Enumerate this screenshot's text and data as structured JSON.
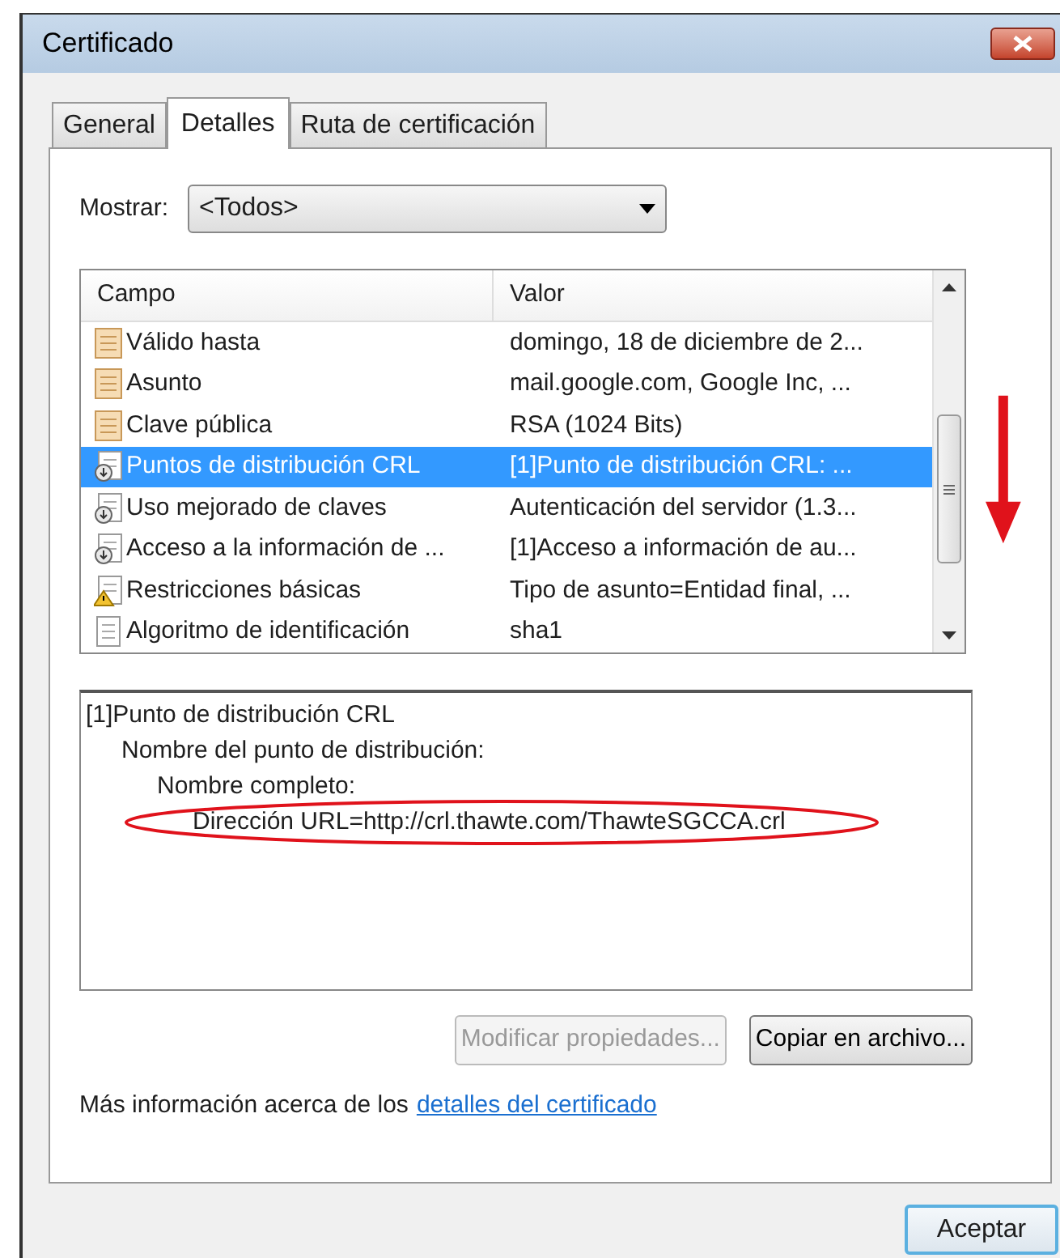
{
  "window": {
    "title": "Certificado"
  },
  "tabs": [
    {
      "label": "General",
      "selected": false
    },
    {
      "label": "Detalles",
      "selected": true
    },
    {
      "label": "Ruta de certificación",
      "selected": false
    }
  ],
  "show": {
    "label": "Mostrar:",
    "value": "<Todos>"
  },
  "fields": {
    "columns": [
      "Campo",
      "Valor"
    ],
    "rows": [
      {
        "kind": "cert",
        "field": "Válido hasta",
        "value": "domingo, 18 de diciembre de 2...",
        "selected": false
      },
      {
        "kind": "cert",
        "field": "Asunto",
        "value": "mail.google.com, Google Inc, ...",
        "selected": false
      },
      {
        "kind": "cert",
        "field": "Clave pública",
        "value": "RSA (1024 Bits)",
        "selected": false
      },
      {
        "kind": "extension",
        "field": "Puntos de distribución CRL",
        "value": "[1]Punto de distribución CRL: ...",
        "selected": true
      },
      {
        "kind": "extension",
        "field": "Uso mejorado de claves",
        "value": "Autenticación del servidor (1.3...",
        "selected": false
      },
      {
        "kind": "extension",
        "field": "Acceso a la información de ...",
        "value": "[1]Acceso a información de au...",
        "selected": false
      },
      {
        "kind": "warning",
        "field": "Restricciones básicas",
        "value": "Tipo de asunto=Entidad final, ...",
        "selected": false
      },
      {
        "kind": "plain",
        "field": "Algoritmo de identificación",
        "value": "sha1",
        "selected": false
      }
    ]
  },
  "detail": [
    {
      "text": "[1]Punto de distribución CRL",
      "children": [
        {
          "text": "Nombre del punto de distribución:",
          "children": [
            {
              "text": "Nombre completo:",
              "children": [
                {
                  "text": "Dirección URL=http://crl.thawte.com/ThawteSGCCA.crl",
                  "highlighted": true
                }
              ]
            }
          ]
        }
      ]
    }
  ],
  "buttons": [
    {
      "label": "Modificar propiedades...",
      "disabled": true
    },
    {
      "label": "Copiar en archivo...",
      "disabled": false
    }
  ],
  "info": {
    "text": "Más información acerca de los",
    "link": "detalles del certificado"
  },
  "footer": {
    "button": "Aceptar"
  }
}
